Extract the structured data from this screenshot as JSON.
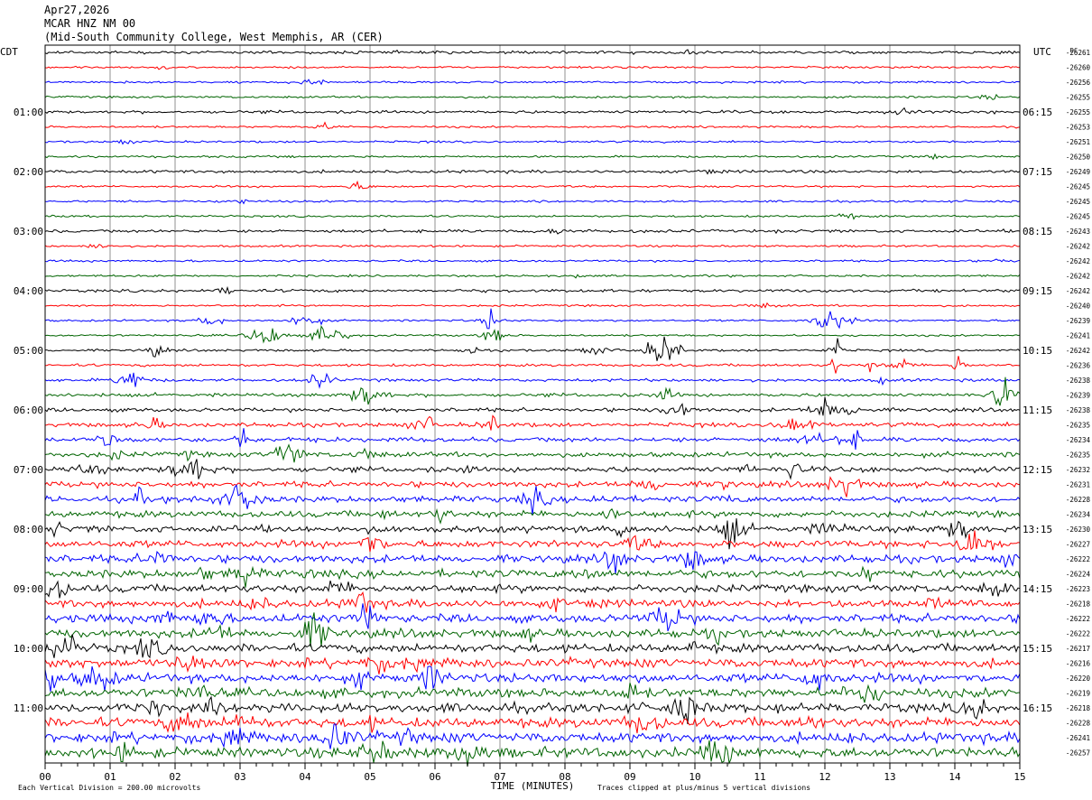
{
  "header": {
    "date": "Apr27,2026",
    "station": "MCAR HNZ NM 00",
    "location": "(Mid-South Community College, West Memphis, AR (CER)"
  },
  "chart_data": {
    "type": "line",
    "left_timezone": "CDT",
    "right_timezone": "UTC",
    "dc_label": "DC",
    "xlabel": "TIME (MINUTES)",
    "xlim": [
      0,
      15
    ],
    "x_ticks": [
      "00",
      "01",
      "02",
      "03",
      "04",
      "05",
      "06",
      "07",
      "08",
      "09",
      "10",
      "11",
      "12",
      "13",
      "14",
      "15"
    ],
    "left_hour_labels": [
      "01:00",
      "02:00",
      "03:00",
      "04:00",
      "05:00",
      "06:00",
      "07:00",
      "08:00",
      "09:00",
      "10:00",
      "11:00"
    ],
    "right_hour_labels": [
      "06:15",
      "07:15",
      "08:15",
      "09:15",
      "10:15",
      "11:15",
      "12:15",
      "13:15",
      "14:15",
      "15:15",
      "16:15"
    ],
    "trace_colors": [
      "#000000",
      "#ff0000",
      "#0000ff",
      "#006400"
    ],
    "trace_count": 48,
    "dc_offsets": [
      "-26261",
      "-26260",
      "-26256",
      "-26255",
      "-26255",
      "-26253",
      "-26251",
      "-26250",
      "-26249",
      "-26245",
      "-26245",
      "-26245",
      "-26243",
      "-26242",
      "-26242",
      "-26242",
      "-26242",
      "-26240",
      "-26239",
      "-26241",
      "-26242",
      "-26236",
      "-26238",
      "-26239",
      "-26238",
      "-26235",
      "-26234",
      "-26235",
      "-26232",
      "-26231",
      "-26228",
      "-26234",
      "-26230",
      "-26227",
      "-26222",
      "-26224",
      "-26223",
      "-26218",
      "-26222",
      "-26222",
      "-26217",
      "-26216",
      "-26220",
      "-26219",
      "-26218",
      "-26228",
      "-26241",
      "-26257"
    ],
    "footer_left": "Each Vertical Division =  200.00 microvolts",
    "footer_right": "Traces clipped at plus/minus 5 vertical divisions"
  }
}
